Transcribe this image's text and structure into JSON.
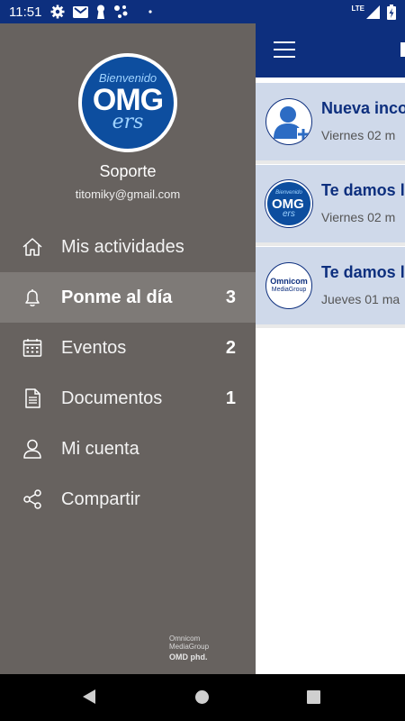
{
  "status_bar": {
    "time": "11:51",
    "left_icons": [
      "gear-icon",
      "gmail-icon",
      "keyhole-icon",
      "assistant-dots-icon",
      "dot-icon"
    ],
    "network": "LTE",
    "right_icons": [
      "signal-icon",
      "battery-charging-icon"
    ]
  },
  "app_bar": {
    "menu_icon": "hamburger-icon",
    "background": "#0d2f7e"
  },
  "feed": {
    "items": [
      {
        "title": "Nueva inco",
        "date": "Viernes 02 m",
        "avatar": "user-add-icon"
      },
      {
        "title": "Te damos la",
        "date": "Viernes 02 m",
        "avatar": "omgers-logo"
      },
      {
        "title": "Te damos la",
        "date": "Jueves 01 ma",
        "avatar": "omnicom-logo"
      }
    ]
  },
  "drawer": {
    "logo": {
      "top_text": "Bienvenido",
      "main_text": "OMG",
      "script_text": "ers"
    },
    "profile": {
      "name": "Soporte",
      "email": "titomiky@gmail.com"
    },
    "menu": [
      {
        "label": "Mis actividades",
        "icon": "home-icon",
        "count": ""
      },
      {
        "label": "Ponme al día",
        "icon": "bell-icon",
        "count": "3",
        "active": true
      },
      {
        "label": "Eventos",
        "icon": "calendar-icon",
        "count": "2"
      },
      {
        "label": "Documentos",
        "icon": "document-icon",
        "count": "1"
      },
      {
        "label": "Mi cuenta",
        "icon": "person-icon",
        "count": ""
      },
      {
        "label": "Compartir",
        "icon": "share-icon",
        "count": ""
      }
    ],
    "footer": {
      "line1": "Omnicom",
      "line2": "MediaGroup",
      "logos": "OMD   phd."
    }
  },
  "colors": {
    "primary": "#0d2f7e",
    "drawer_bg": "#67625f",
    "drawer_active": "#7e7a77",
    "feed_item_bg": "#cfd9ea"
  }
}
